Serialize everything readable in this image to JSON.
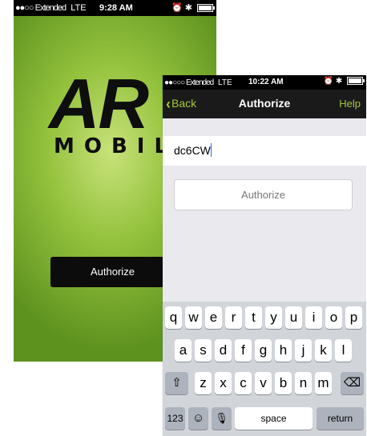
{
  "back_screen": {
    "status": {
      "signal": "●●○○ Extended",
      "network": "LTE",
      "time": "9:28 AM",
      "icons": "⏰ ✱"
    },
    "logo_main": "AR",
    "logo_sub": "MOBIL",
    "authorize_button": "Authorize"
  },
  "front_screen": {
    "status": {
      "signal": "●●○○○ Extended",
      "network": "LTE",
      "time": "10:22 AM",
      "icons": "⏰ ✱"
    },
    "nav": {
      "back_label": "Back",
      "title": "Authorize",
      "help_label": "Help"
    },
    "code_value": "dc6CW",
    "authorize_button": "Authorize",
    "keyboard": {
      "row1": [
        "q",
        "w",
        "e",
        "r",
        "t",
        "y",
        "u",
        "i",
        "o",
        "p"
      ],
      "row2": [
        "a",
        "s",
        "d",
        "f",
        "g",
        "h",
        "j",
        "k",
        "l"
      ],
      "row3": [
        "z",
        "x",
        "c",
        "v",
        "b",
        "n",
        "m"
      ],
      "shift_icon": "⇧",
      "delete_icon": "⌫",
      "numbers_label": "123",
      "emoji_icon": "☺",
      "mic_icon": "🎙",
      "space_label": "space",
      "return_label": "return"
    }
  },
  "colors": {
    "accent": "#a4c83a",
    "nav_bg": "#1a1a1a",
    "splash_green": "#94c23d"
  }
}
